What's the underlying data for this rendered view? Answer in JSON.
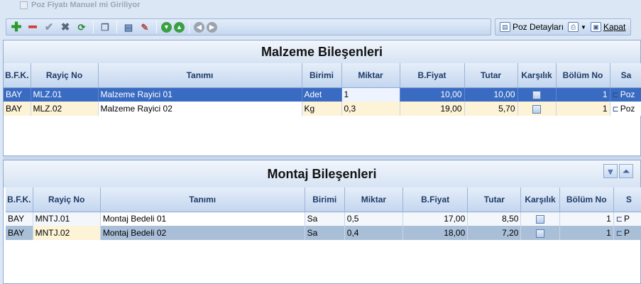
{
  "manual_price_checkbox": {
    "label": "Poz Fiyatı Manuel mi Giriliyor",
    "checked": false
  },
  "toolbar2": {
    "details_label": "Poz Detayları",
    "close_label": "Kapat"
  },
  "materials": {
    "title": "Malzeme Bileşenleri",
    "columns": [
      "B.F.K.",
      "Rayiç No",
      "Tanımı",
      "Birimi",
      "Miktar",
      "B.Fiyat",
      "Tutar",
      "Karşılık",
      "Bölüm No",
      "Sa"
    ],
    "rows": [
      {
        "bfk": "BAY",
        "rayic_no": "MLZ.01",
        "tanimi": "Malzeme Rayici 01",
        "birimi": "Adet",
        "miktar": "1",
        "bfiyat": "10,00",
        "tutar": "10,00",
        "bolum_no": "1",
        "sa": "Poz"
      },
      {
        "bfk": "BAY",
        "rayic_no": "MLZ.02",
        "tanimi": "Malzeme Rayici 02",
        "birimi": "Kg",
        "miktar": "0,3",
        "bfiyat": "19,00",
        "tutar": "5,70",
        "bolum_no": "1",
        "sa": "Poz"
      }
    ]
  },
  "assembly": {
    "title": "Montaj Bileşenleri",
    "columns": [
      "B.F.K.",
      "Rayiç No",
      "Tanımı",
      "Birimi",
      "Miktar",
      "B.Fiyat",
      "Tutar",
      "Karşılık",
      "Bölüm No",
      "S"
    ],
    "rows": [
      {
        "bfk": "BAY",
        "rayic_no": "MNTJ.01",
        "tanimi": "Montaj Bedeli 01",
        "birimi": "Sa",
        "miktar": "0,5",
        "bfiyat": "17,00",
        "tutar": "8,50",
        "bolum_no": "1",
        "sa": "P"
      },
      {
        "bfk": "BAY",
        "rayic_no": "MNTJ.02",
        "tanimi": "Montaj Bedeli 02",
        "birimi": "Sa",
        "miktar": "0,4",
        "bfiyat": "18,00",
        "tutar": "7,20",
        "bolum_no": "1",
        "sa": "P"
      }
    ]
  }
}
